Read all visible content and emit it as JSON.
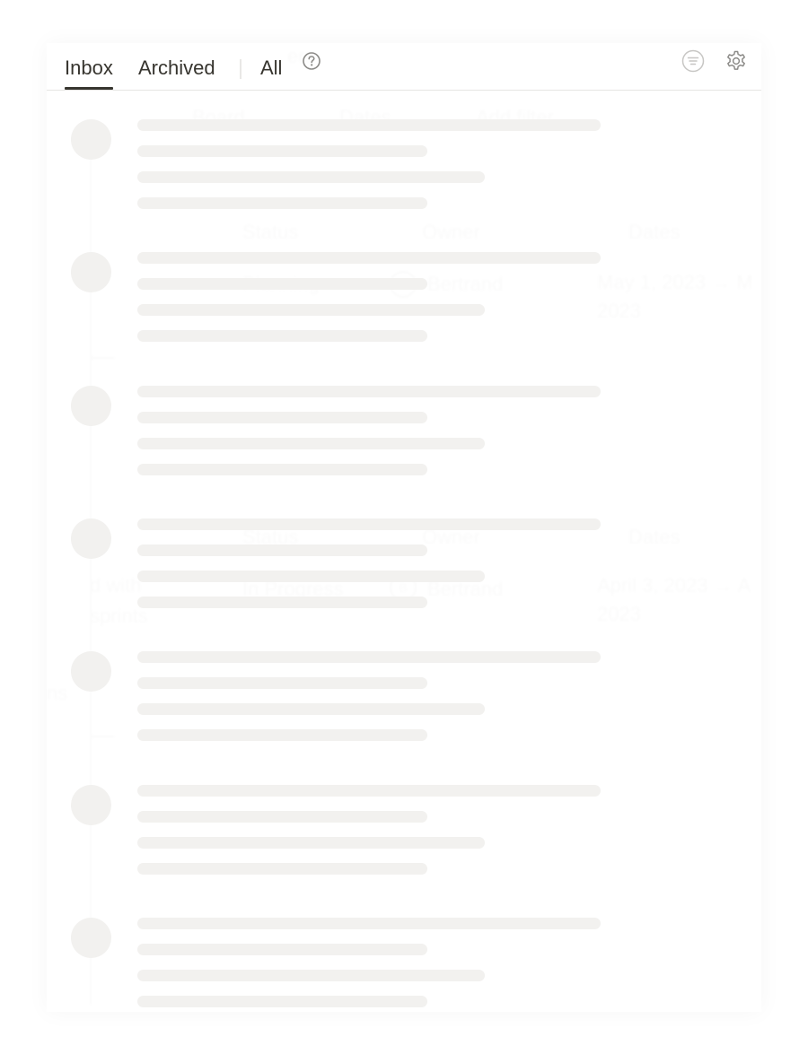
{
  "tabs": {
    "inbox": "Inbox",
    "archived": "Archived",
    "all": "All"
  },
  "icons": {
    "help": "help-circle-icon",
    "filter": "filter-lines-icon",
    "settings": "gear-icon"
  },
  "colors": {
    "text": "#37352f",
    "skeleton": "#f2f1ef",
    "divider": "#e6e5e3",
    "icon_muted": "#c7c6c4",
    "icon": "#8c8b88"
  },
  "skeleton_item_count": 7,
  "background_page": {
    "header_fragment": "ers",
    "toolbar": [
      "Board",
      "Dates",
      "Add filter"
    ],
    "group_1": {
      "columns": [
        "Status",
        "Owner",
        "Dates"
      ],
      "status": "Planning",
      "owner_initial": "B",
      "owner": "Bertrand",
      "dates_line1": "May 1, 2023 → M",
      "dates_line2": "2023"
    },
    "group_2": {
      "columns": [
        "Status",
        "Owner",
        "Dates"
      ],
      "status": "In Progress",
      "owner_initial": "B",
      "owner": "Bertrand",
      "dates_line1": "April 3, 2023 → A",
      "dates_line2": "2023",
      "title_line1": "d with",
      "title_line2": "sprints",
      "left_fragment": "ns"
    }
  }
}
